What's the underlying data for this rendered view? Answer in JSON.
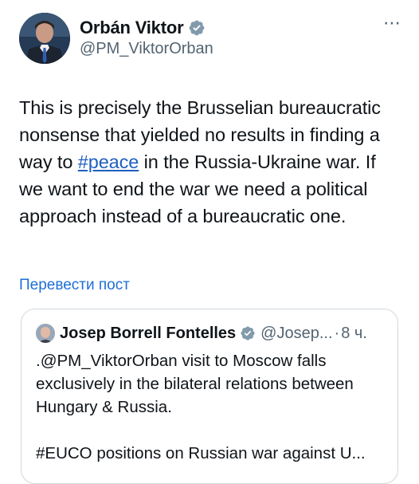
{
  "author": {
    "name": "Orbán Viktor",
    "handle": "@PM_ViktorOrban"
  },
  "more_icon": "⋯",
  "tweet": {
    "text_before": "This is precisely the Brusselian bureaucratic nonsense that yielded no results in finding a way to ",
    "hashtag": "#peace",
    "text_after": " in the Russia-Ukraine war. If we want to end the war we need a political approach instead of a bureaucratic one."
  },
  "translate_label": "Перевести пост",
  "quote": {
    "name": "Josep Borrell Fontelles",
    "handle": "@Josep...",
    "separator": "·",
    "time": "8 ч.",
    "text": ".@PM_ViktorOrban visit to Moscow falls exclusively in the bilateral relations between Hungary & Russia.\n\n#EUCO positions on Russian war against U..."
  },
  "colors": {
    "link": "#1d5fbf",
    "verified": "#829aab",
    "secondary_text": "#536471",
    "border": "#cfd9de"
  }
}
